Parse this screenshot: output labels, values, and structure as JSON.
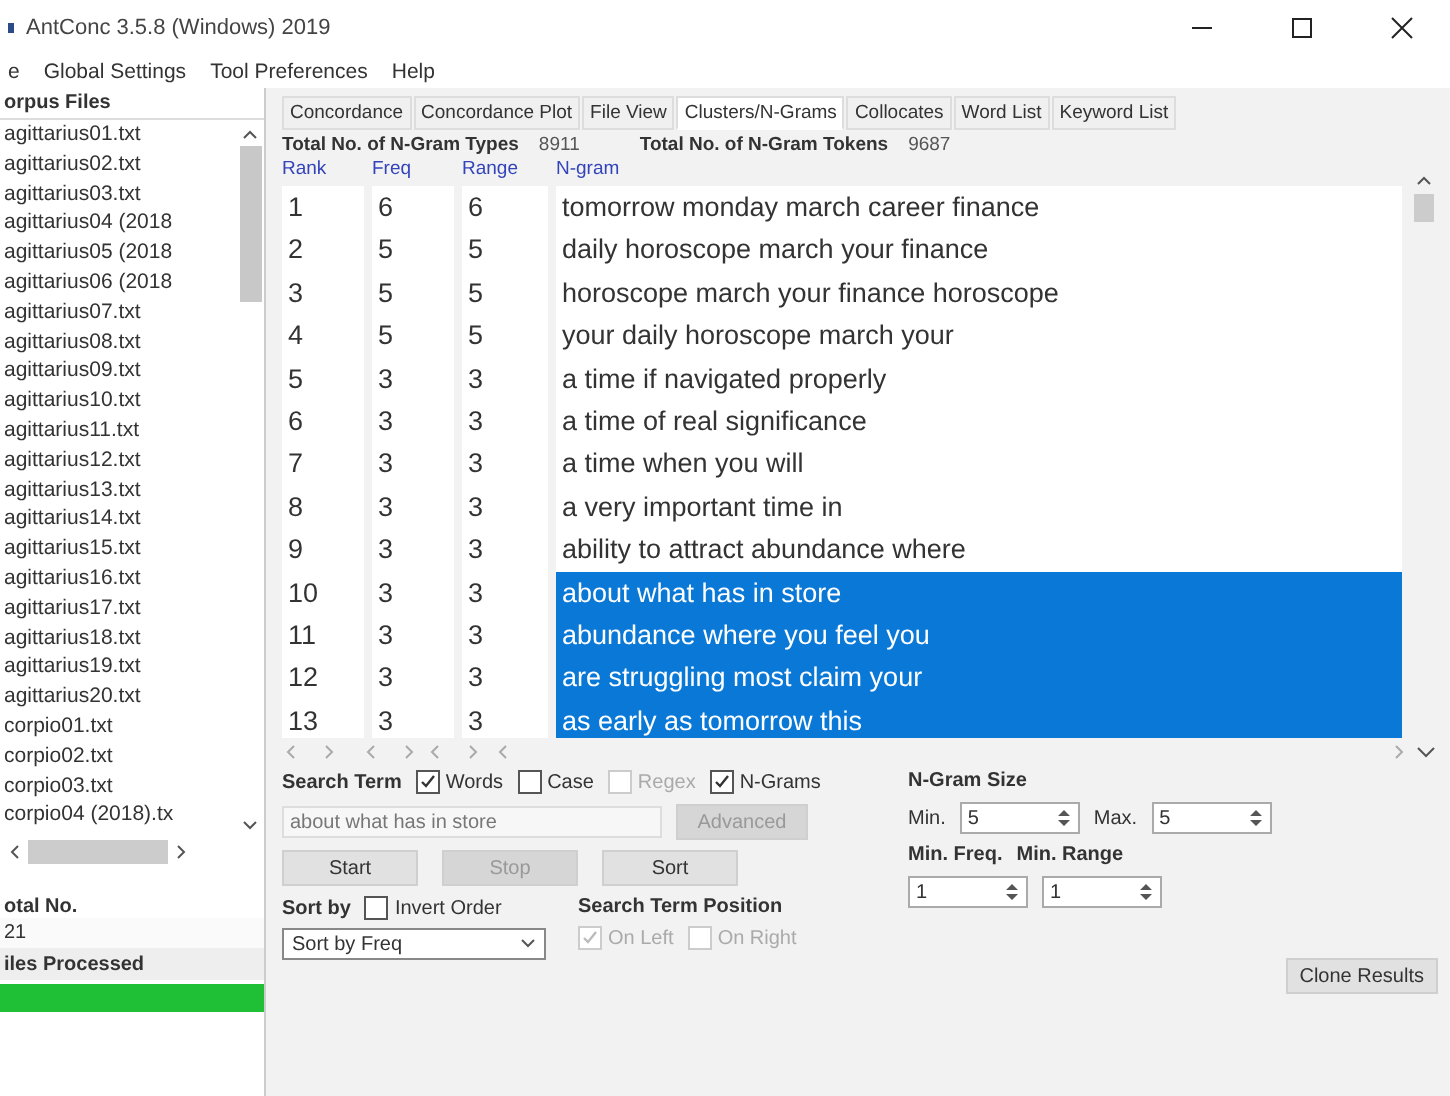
{
  "window": {
    "title": "AntConc 3.5.8 (Windows) 2019"
  },
  "menu": [
    "e",
    "Global Settings",
    "Tool Preferences",
    "Help"
  ],
  "corpus": {
    "title": "orpus Files",
    "files": [
      "agittarius01.txt",
      "agittarius02.txt",
      "agittarius03.txt",
      "agittarius04 (2018",
      "agittarius05 (2018",
      "agittarius06 (2018",
      "agittarius07.txt",
      "agittarius08.txt",
      "agittarius09.txt",
      "agittarius10.txt",
      "agittarius11.txt",
      "agittarius12.txt",
      "agittarius13.txt",
      "agittarius14.txt",
      "agittarius15.txt",
      "agittarius16.txt",
      "agittarius17.txt",
      "agittarius18.txt",
      "agittarius19.txt",
      "agittarius20.txt",
      "corpio01.txt",
      "corpio02.txt",
      "corpio03.txt",
      "corpio04 (2018).tx"
    ],
    "total_label": "otal No.",
    "total_value": "21",
    "processed_label": "iles Processed",
    "progress": {
      "level": 1
    }
  },
  "tabs": [
    {
      "label": "Concordance",
      "selected": false
    },
    {
      "label": "Concordance Plot",
      "selected": false
    },
    {
      "label": "File View",
      "selected": false
    },
    {
      "label": "Clusters/N-Grams",
      "selected": true
    },
    {
      "label": "Collocates",
      "selected": false
    },
    {
      "label": "Word List",
      "selected": false
    },
    {
      "label": "Keyword List",
      "selected": false
    }
  ],
  "stats": {
    "types_label": "Total No. of N-Gram Types",
    "types_value": "8911",
    "tokens_label": "Total No. of N-Gram Tokens",
    "tokens_value": "9687"
  },
  "table": {
    "columns": [
      "Rank",
      "Freq",
      "Range",
      "N-gram"
    ],
    "rows": [
      {
        "rank": "1",
        "freq": "6",
        "range": "6",
        "ngram": "tomorrow monday march career finance",
        "selected": false
      },
      {
        "rank": "2",
        "freq": "5",
        "range": "5",
        "ngram": "daily horoscope march your finance",
        "selected": false
      },
      {
        "rank": "3",
        "freq": "5",
        "range": "5",
        "ngram": "horoscope march your finance horoscope",
        "selected": false
      },
      {
        "rank": "4",
        "freq": "5",
        "range": "5",
        "ngram": "your daily horoscope march your",
        "selected": false
      },
      {
        "rank": "5",
        "freq": "3",
        "range": "3",
        "ngram": "a time if navigated properly",
        "selected": false
      },
      {
        "rank": "6",
        "freq": "3",
        "range": "3",
        "ngram": "a time of real significance",
        "selected": false
      },
      {
        "rank": "7",
        "freq": "3",
        "range": "3",
        "ngram": "a time when you will",
        "selected": false
      },
      {
        "rank": "8",
        "freq": "3",
        "range": "3",
        "ngram": "a very important time in",
        "selected": false
      },
      {
        "rank": "9",
        "freq": "3",
        "range": "3",
        "ngram": "ability to attract abundance where",
        "selected": false
      },
      {
        "rank": "10",
        "freq": "3",
        "range": "3",
        "ngram": "about what has in store",
        "selected": true
      },
      {
        "rank": "11",
        "freq": "3",
        "range": "3",
        "ngram": "abundance where you feel you",
        "selected": true
      },
      {
        "rank": "12",
        "freq": "3",
        "range": "3",
        "ngram": "are struggling most claim your",
        "selected": true
      },
      {
        "rank": "13",
        "freq": "3",
        "range": "3",
        "ngram": "as early as tomorrow this",
        "selected": true
      }
    ]
  },
  "search": {
    "label": "Search Term",
    "options": [
      {
        "label": "Words",
        "checked": true,
        "disabled": false
      },
      {
        "label": "Case",
        "checked": false,
        "disabled": false
      },
      {
        "label": "Regex",
        "checked": false,
        "disabled": true
      },
      {
        "label": "N-Grams",
        "checked": true,
        "disabled": false
      }
    ],
    "value": "about what has in store",
    "advanced": {
      "label": "Advanced",
      "disabled": true
    },
    "buttons": [
      {
        "label": "Start",
        "disabled": false
      },
      {
        "label": "Stop",
        "disabled": true
      },
      {
        "label": "Sort",
        "disabled": false
      }
    ]
  },
  "sort": {
    "label": "Sort by",
    "invert": {
      "label": "Invert Order",
      "checked": false
    },
    "value": "Sort by Freq"
  },
  "position": {
    "label": "Search Term Position",
    "options": [
      {
        "label": "On Left",
        "checked": true,
        "disabled": true
      },
      {
        "label": "On Right",
        "checked": false,
        "disabled": true
      }
    ]
  },
  "ngram_size": {
    "label": "N-Gram Size",
    "min_label": "Min.",
    "min": "5",
    "max_label": "Max.",
    "max": "5"
  },
  "min_freq": {
    "label": "Min. Freq.",
    "value": "1"
  },
  "min_range": {
    "label": "Min. Range",
    "value": "1"
  },
  "clone": "Clone Results"
}
